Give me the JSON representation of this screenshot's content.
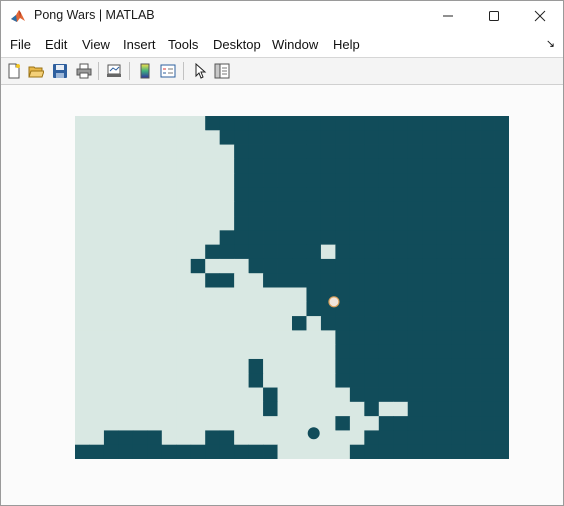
{
  "window": {
    "title": "Pong Wars | MATLAB",
    "app_icon": "matlab-logo-icon",
    "controls": [
      "minimize-icon",
      "maximize-icon",
      "close-icon"
    ]
  },
  "menubar": {
    "items": [
      "File",
      "Edit",
      "View",
      "Insert",
      "Tools",
      "Desktop",
      "Window",
      "Help"
    ],
    "dock_icon": "dock-arrow-icon"
  },
  "toolbar": {
    "buttons": [
      "new-figure-icon",
      "open-file-icon",
      "save-icon",
      "print-icon",
      "link-plot-icon",
      "colorbar-icon",
      "legend-icon",
      "pointer-icon",
      "property-editor-icon"
    ]
  },
  "game": {
    "colors": {
      "day": "#d9e8e3",
      "night": "#114c5a",
      "day_ball": "#f2e6dc",
      "night_ball": "#114c5a",
      "ball_outline": "#d9a05b"
    },
    "grid": {
      "cols": 30,
      "rows": 24
    },
    "day_ball_cell": [
      17.9,
      13.0
    ],
    "night_ball_cell": [
      16.5,
      22.2
    ]
  }
}
